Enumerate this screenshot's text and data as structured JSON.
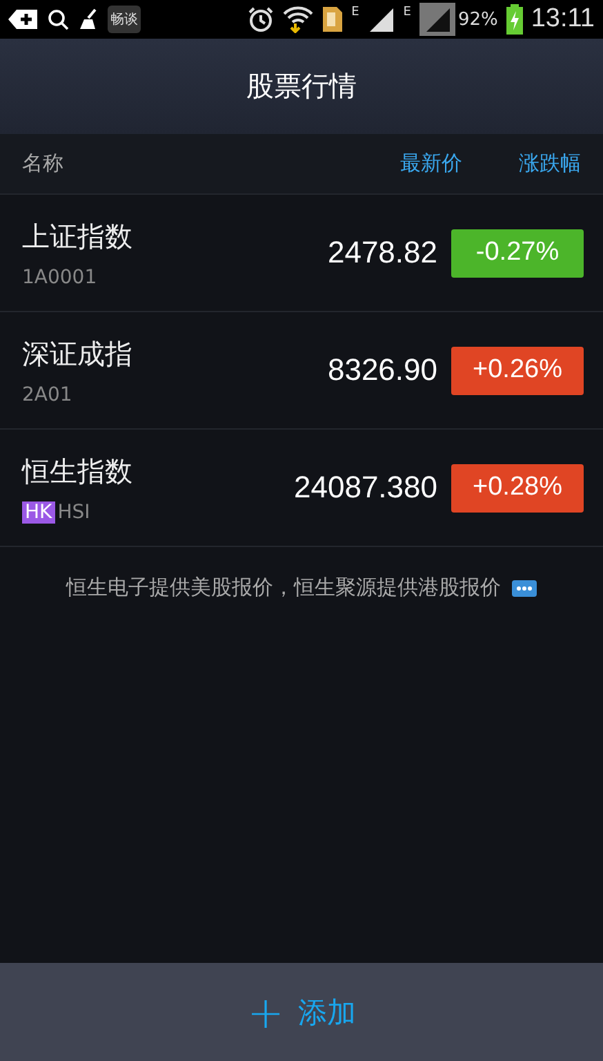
{
  "status_bar": {
    "app_label": "畅谈",
    "network_labels": [
      "E",
      "E"
    ],
    "battery": "92%",
    "time": "13:11"
  },
  "header": {
    "title": "股票行情"
  },
  "columns": [
    "名称",
    "最新价",
    "涨跌幅"
  ],
  "rows": [
    {
      "name": "上证指数",
      "code": "1A0001",
      "price": "2478.82",
      "change": "-0.27%",
      "color": "#4cb52a"
    },
    {
      "name": "深证成指",
      "code": "2A01",
      "price": "8326.90",
      "change": "+0.26%",
      "color": "#e04524"
    },
    {
      "name": "恒生指数",
      "tag": "HK",
      "code": "HSI",
      "price": "24087.380",
      "change": "+0.28%",
      "color": "#e04524"
    }
  ],
  "notice": "恒生电子提供美股报价，恒生聚源提供港股报价",
  "footer": {
    "icon": "+",
    "label": "添加"
  }
}
